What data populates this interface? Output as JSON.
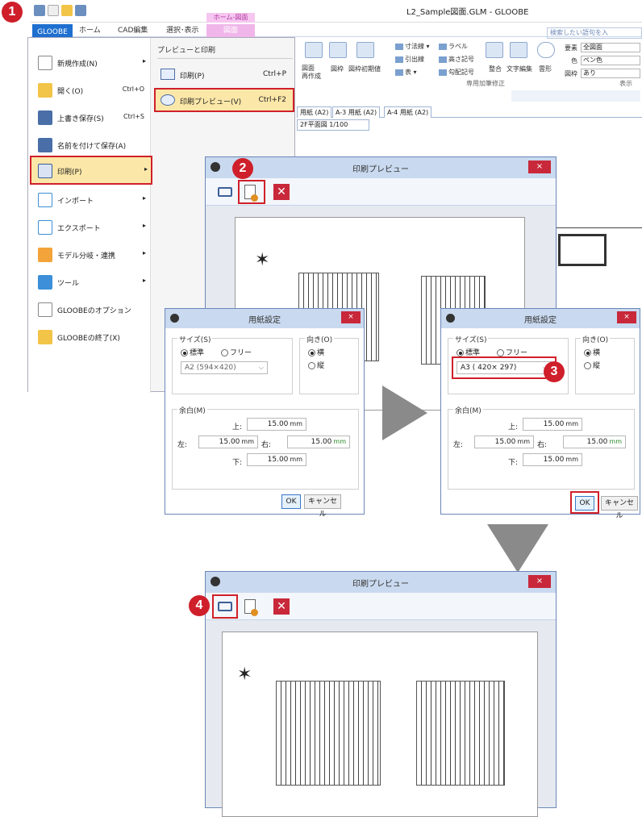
{
  "window": {
    "title": "L2_Sample図面.GLM - GLOOBE"
  },
  "ribbon": {
    "file_tab": "GLOOBE",
    "tabs": [
      "ホーム",
      "CAD編集",
      "選択･表示"
    ],
    "context_header": "ホーム-図面",
    "context_tab": "図面",
    "search_placeholder": "検索したい語句を入",
    "groups": {
      "drawing_create": "図面\n再作成",
      "frame": "図枠",
      "frame_init": "図枠初期値",
      "dimension": "寸法線",
      "leader": "引出線",
      "table": "表",
      "label": "ラベル",
      "height_mark": "高さ記号",
      "slope_mark": "勾配記号",
      "align": "整合",
      "text_edit": "文字編集",
      "cloud": "雲形",
      "annotation_group": "専用加筆修正",
      "element_label": "要素",
      "element_value": "全図面",
      "color_label": "色",
      "color_value": "ペン色",
      "frame_label": "図枠",
      "frame_value": "あり",
      "display_group": "表示"
    },
    "doc_tabs": [
      "用紙 (A2)",
      "A-3 用紙 (A2)",
      "A-4 用紙 (A2)"
    ],
    "view_label": "2F平面図 1/100"
  },
  "filemenu": {
    "items": [
      {
        "label": "新規作成(N)",
        "shortcut": "",
        "arrow": "▸"
      },
      {
        "label": "開く(O)",
        "shortcut": "Ctrl+O",
        "arrow": ""
      },
      {
        "label": "上書き保存(S)",
        "shortcut": "Ctrl+S",
        "arrow": ""
      },
      {
        "label": "名前を付けて保存(A)",
        "shortcut": "",
        "arrow": ""
      },
      {
        "label": "印刷(P)",
        "shortcut": "",
        "arrow": "▸"
      },
      {
        "label": "インポート",
        "shortcut": "",
        "arrow": "▸"
      },
      {
        "label": "エクスポート",
        "shortcut": "",
        "arrow": "▸"
      },
      {
        "label": "モデル分岐・連携",
        "shortcut": "",
        "arrow": "▸"
      },
      {
        "label": "ツール",
        "shortcut": "",
        "arrow": "▸"
      },
      {
        "label": "GLOOBEのオプション",
        "shortcut": "",
        "arrow": ""
      },
      {
        "label": "GLOOBEの終了(X)",
        "shortcut": "",
        "arrow": ""
      }
    ],
    "submenu": {
      "title": "プレビューと印刷",
      "print": {
        "label": "印刷(P)",
        "shortcut": "Ctrl+P"
      },
      "preview": {
        "label": "印刷プレビュー(V)",
        "shortcut": "Ctrl+F2"
      }
    }
  },
  "steps": [
    "1",
    "2",
    "3",
    "4"
  ],
  "preview_dialog": {
    "title": "印刷プレビュー",
    "close": "×"
  },
  "paper_setup": {
    "title": "用紙設定",
    "close": "×",
    "size_label": "サイズ(S)",
    "standard": "標準",
    "free": "フリー",
    "orientation_label": "向き(O)",
    "landscape": "横",
    "portrait": "縦",
    "margin_label": "余白(M)",
    "top": "上:",
    "left": "左:",
    "right": "右:",
    "bottom": "下:",
    "margin_value": "15.00",
    "unit": "mm",
    "ok": "OK",
    "cancel": "キャンセル",
    "before": {
      "size_value": "A2 (594×420)"
    },
    "after": {
      "size_value": "A3 ( 420× 297)"
    }
  }
}
